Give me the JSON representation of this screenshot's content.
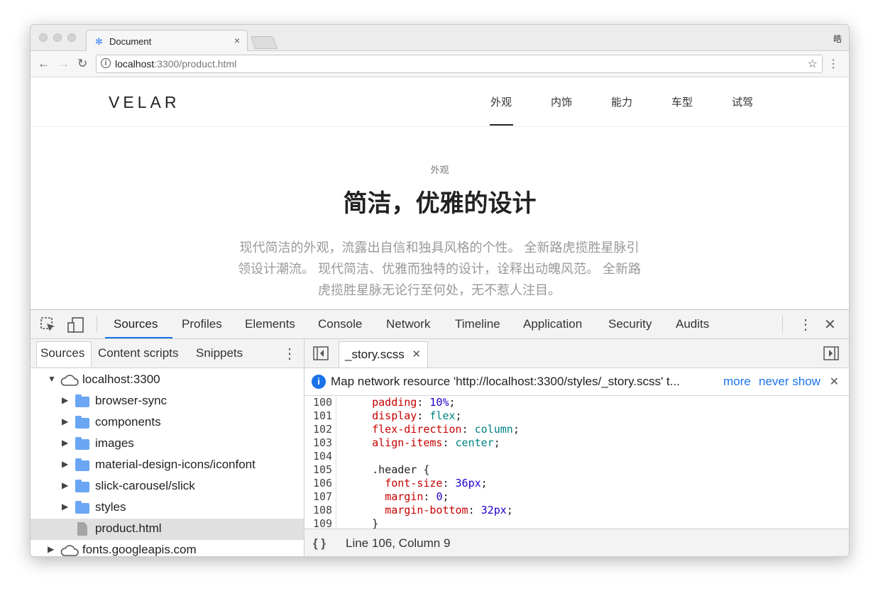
{
  "browser": {
    "tab_title": "Document",
    "profile": "皓",
    "url_host": "localhost",
    "url_path": ":3300/product.html",
    "icons": [
      "back-icon",
      "forward-icon",
      "reload-icon",
      "info-icon",
      "star-icon",
      "more-vert-icon"
    ]
  },
  "site": {
    "logo": "VELAR",
    "nav": [
      "外观",
      "内饰",
      "能力",
      "车型",
      "试驾"
    ],
    "eyebrow": "外观",
    "headline": "简洁，优雅的设计",
    "description_lines": [
      "现代简洁的外观，流露出自信和独具风格的个性。 全新路虎揽胜星脉引",
      "领设计潮流。 现代简洁、优雅而独特的设计，诠释出动魄风范。 全新路",
      "虎揽胜星脉无论行至何处，无不惹人注目。"
    ]
  },
  "devtools": {
    "tabs": [
      "Sources",
      "Profiles",
      "Elements",
      "Console",
      "Network",
      "Timeline",
      "Application",
      "Security",
      "Audits"
    ],
    "navigator_tabs": [
      "Sources",
      "Content scripts",
      "Snippets"
    ],
    "tree": [
      {
        "label": "localhost:3300",
        "type": "cloud",
        "expanded": true
      },
      {
        "label": "browser-sync",
        "type": "folder"
      },
      {
        "label": "components",
        "type": "folder"
      },
      {
        "label": "images",
        "type": "folder"
      },
      {
        "label": "material-design-icons/iconfont",
        "type": "folder"
      },
      {
        "label": "slick-carousel/slick",
        "type": "folder"
      },
      {
        "label": "styles",
        "type": "folder"
      },
      {
        "label": "product.html",
        "type": "file",
        "selected": true
      },
      {
        "label": "fonts.googleapis.com",
        "type": "cloud",
        "expanded": false
      }
    ],
    "editor_tab": "_story.scss",
    "infobar": {
      "message": "Map network resource 'http://localhost:3300/styles/_story.scss' t...",
      "more": "more",
      "never_show": "never show"
    },
    "code_lines": [
      {
        "n": "100",
        "indent": "    ",
        "prop": "padding",
        "val": "10%",
        "vtype": "num"
      },
      {
        "n": "101",
        "indent": "    ",
        "prop": "display",
        "val": "flex",
        "vtype": "kw"
      },
      {
        "n": "102",
        "indent": "    ",
        "prop": "flex-direction",
        "val": "column",
        "vtype": "kw"
      },
      {
        "n": "103",
        "indent": "    ",
        "prop": "align-items",
        "val": "center",
        "vtype": "kw"
      },
      {
        "n": "104",
        "text": ""
      },
      {
        "n": "105",
        "text": "    .header {"
      },
      {
        "n": "106",
        "indent": "      ",
        "prop": "font-size",
        "val": "36px",
        "vtype": "num"
      },
      {
        "n": "107",
        "indent": "      ",
        "prop": "margin",
        "val": "0",
        "vtype": "num"
      },
      {
        "n": "108",
        "indent": "      ",
        "prop": "margin-bottom",
        "val": "32px",
        "vtype": "num"
      },
      {
        "n": "109",
        "text": "    }"
      }
    ],
    "status": {
      "braces": "{ }",
      "position": "Line 106, Column 9"
    }
  }
}
